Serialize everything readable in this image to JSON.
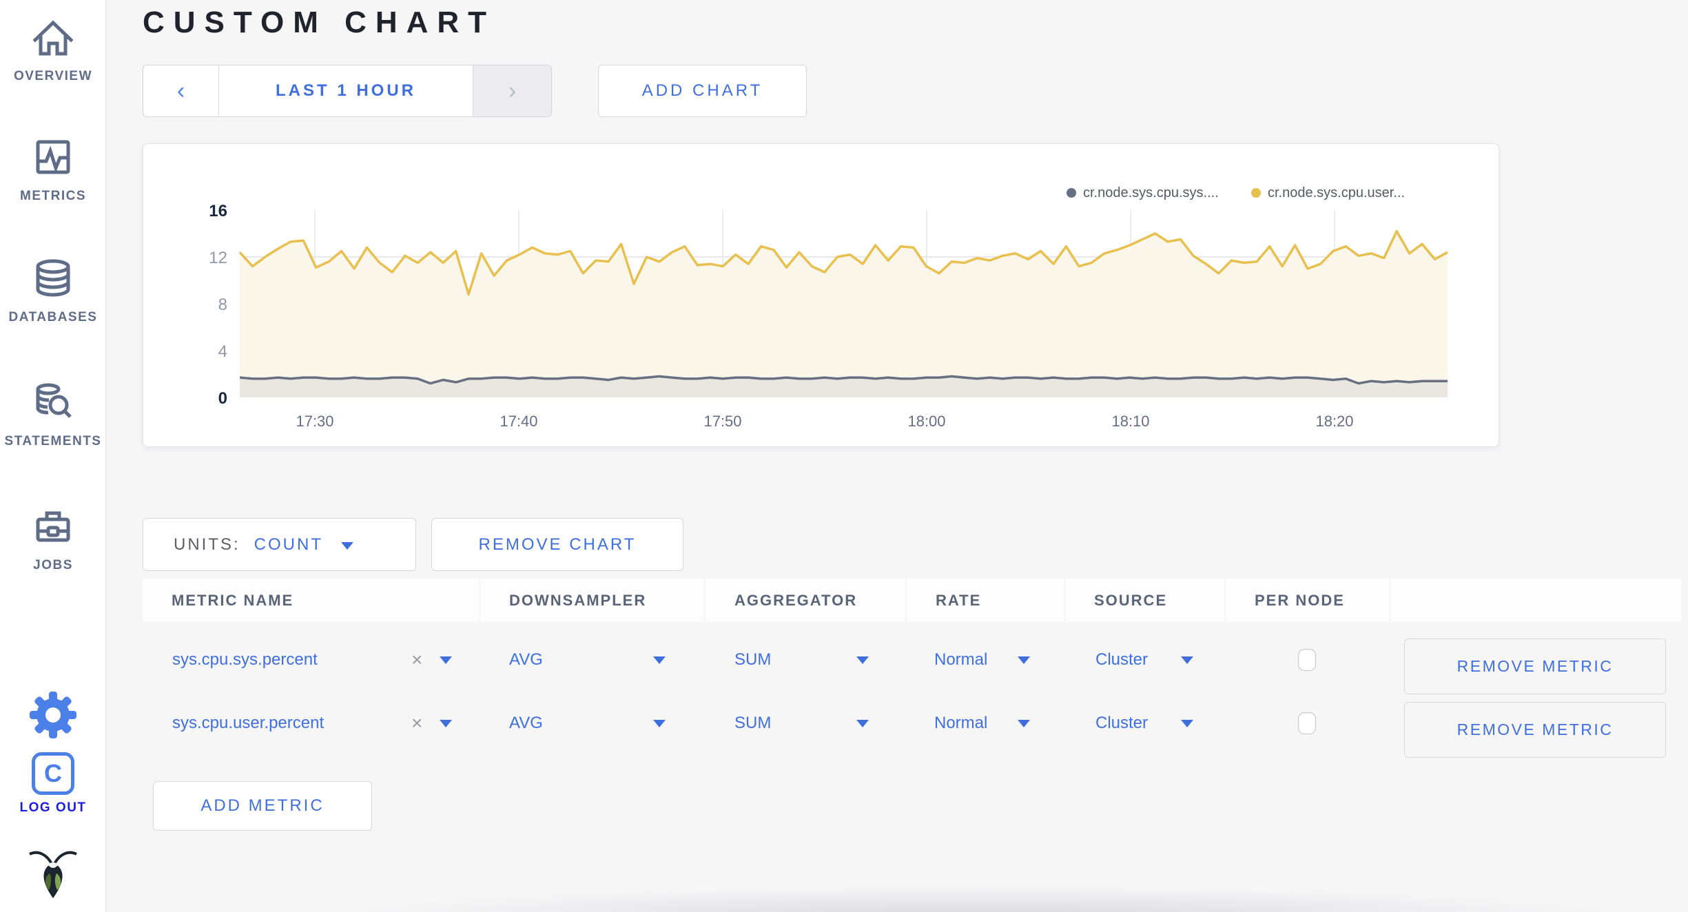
{
  "colors": {
    "accent_blue": "#3f6fdd",
    "logout_blue": "#1d1de0",
    "sidebar_grey": "#5f6c87",
    "series_sys_grey": "#677083",
    "series_user_yellow": "#e7c04f",
    "user_fill": "#faf6e9",
    "sys_fill": "#eae7e1"
  },
  "sidebar": {
    "items": [
      {
        "label": "OVERVIEW",
        "icon": "home-icon"
      },
      {
        "label": "METRICS",
        "icon": "metrics-icon"
      },
      {
        "label": "DATABASES",
        "icon": "database-icon"
      },
      {
        "label": "STATEMENTS",
        "icon": "statements-icon"
      },
      {
        "label": "JOBS",
        "icon": "briefcase-icon"
      }
    ],
    "logout_label": "LOG OUT",
    "logo_letter": "C"
  },
  "header": {
    "title": "CUSTOM CHART"
  },
  "toolbar": {
    "prev_arrow": "‹",
    "time_range_label": "LAST 1 HOUR",
    "next_arrow": "›",
    "add_chart_label": "ADD CHART"
  },
  "chart_data": {
    "type": "line",
    "title": "",
    "ylim": [
      0,
      16
    ],
    "yticks": [
      0,
      4,
      8,
      12,
      16
    ],
    "ytick_strong": [
      0,
      16
    ],
    "xticks": [
      "17:30",
      "17:40",
      "17:50",
      "18:00",
      "18:10",
      "18:20"
    ],
    "x_range": [
      "17:26",
      "18:25"
    ],
    "grid": true,
    "legend_position": "top-right",
    "series": [
      {
        "name": "cr.node.sys.cpu.sys....",
        "color": "#677083",
        "fill": "#eae7e1",
        "values": [
          1.7,
          1.6,
          1.6,
          1.7,
          1.6,
          1.7,
          1.7,
          1.6,
          1.6,
          1.7,
          1.6,
          1.6,
          1.7,
          1.7,
          1.6,
          1.2,
          1.5,
          1.3,
          1.6,
          1.6,
          1.7,
          1.7,
          1.6,
          1.7,
          1.6,
          1.6,
          1.7,
          1.7,
          1.6,
          1.5,
          1.7,
          1.6,
          1.7,
          1.8,
          1.7,
          1.6,
          1.6,
          1.7,
          1.6,
          1.7,
          1.7,
          1.6,
          1.6,
          1.7,
          1.6,
          1.6,
          1.7,
          1.6,
          1.7,
          1.7,
          1.6,
          1.7,
          1.6,
          1.6,
          1.7,
          1.7,
          1.8,
          1.7,
          1.6,
          1.7,
          1.6,
          1.7,
          1.7,
          1.6,
          1.7,
          1.6,
          1.6,
          1.7,
          1.7,
          1.6,
          1.7,
          1.6,
          1.7,
          1.6,
          1.6,
          1.7,
          1.7,
          1.6,
          1.6,
          1.7,
          1.6,
          1.7,
          1.6,
          1.7,
          1.7,
          1.6,
          1.5,
          1.6,
          1.2,
          1.4,
          1.3,
          1.4,
          1.3,
          1.4,
          1.4,
          1.4
        ]
      },
      {
        "name": "cr.node.sys.cpu.user...",
        "color": "#e7c04f",
        "fill": "#faf6e9",
        "values": [
          12.4,
          11.2,
          12.0,
          12.7,
          13.3,
          13.4,
          11.1,
          11.6,
          12.5,
          11.0,
          12.8,
          11.5,
          10.7,
          12.1,
          11.5,
          12.4,
          11.5,
          12.5,
          8.8,
          12.3,
          10.4,
          11.7,
          12.2,
          12.8,
          12.3,
          12.2,
          12.5,
          10.6,
          11.7,
          11.6,
          13.1,
          9.7,
          12.0,
          11.6,
          12.4,
          12.9,
          11.3,
          11.4,
          11.2,
          12.2,
          11.4,
          12.9,
          12.6,
          11.1,
          12.4,
          11.2,
          10.7,
          12.0,
          12.2,
          11.4,
          13.0,
          11.7,
          12.9,
          12.8,
          11.2,
          10.6,
          11.6,
          11.5,
          11.9,
          11.7,
          12.1,
          12.3,
          11.8,
          12.5,
          11.4,
          12.9,
          11.2,
          11.5,
          12.3,
          12.6,
          13.0,
          13.5,
          14.0,
          13.3,
          13.5,
          12.1,
          11.4,
          10.6,
          11.7,
          11.5,
          11.6,
          12.9,
          11.2,
          13.0,
          11.0,
          11.4,
          12.5,
          12.9,
          12.1,
          12.3,
          11.9,
          14.2,
          12.3,
          13.1,
          11.8,
          12.4
        ]
      }
    ]
  },
  "units_bar": {
    "units_label": "UNITS:",
    "units_value": "COUNT",
    "remove_chart_label": "REMOVE CHART"
  },
  "table": {
    "columns": [
      "METRIC NAME",
      "DOWNSAMPLER",
      "AGGREGATOR",
      "RATE",
      "SOURCE",
      "PER NODE"
    ],
    "rows": [
      {
        "metric": "sys.cpu.sys.percent",
        "clear": "×",
        "downsampler": "AVG",
        "aggregator": "SUM",
        "rate": "Normal",
        "source": "Cluster",
        "per_node_checked": false,
        "remove_label": "REMOVE METRIC"
      },
      {
        "metric": "sys.cpu.user.percent",
        "clear": "×",
        "downsampler": "AVG",
        "aggregator": "SUM",
        "rate": "Normal",
        "source": "Cluster",
        "per_node_checked": false,
        "remove_label": "REMOVE METRIC"
      }
    ],
    "add_metric_label": "ADD METRIC"
  }
}
